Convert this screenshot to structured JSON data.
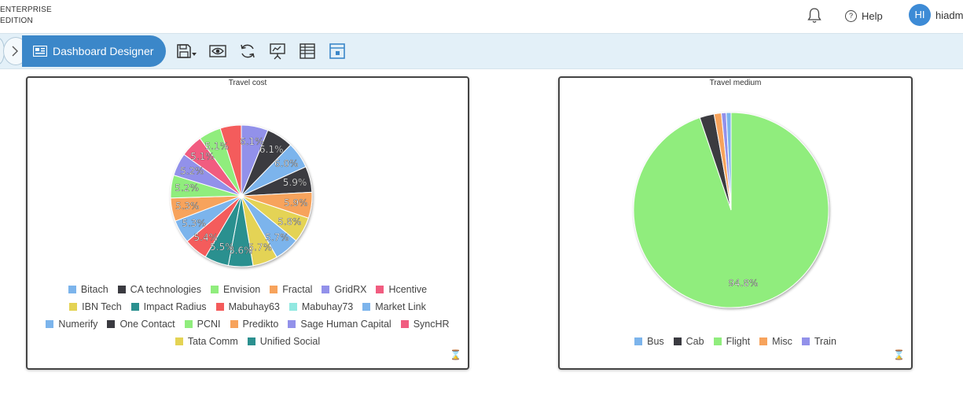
{
  "header": {
    "brand_line1": "ENTERPRISE",
    "brand_line2": "EDITION",
    "help_label": "Help",
    "avatar_initials": "HI",
    "username": "hiadm"
  },
  "toolbar": {
    "dashboard_designer_label": "Dashboard Designer",
    "icons": [
      "save-icon",
      "preview-icon",
      "refresh-icon",
      "presentation-icon",
      "table-icon",
      "layout-icon"
    ]
  },
  "colors": {
    "accent": "#3b87c9",
    "toolbar_bg": "#e3f0f8"
  },
  "chart_data": [
    {
      "type": "pie",
      "title": "Travel cost",
      "legend_rows": [
        [
          "Bitach",
          "CA technologies",
          "Envision",
          "Fractal",
          "GridRX",
          "Hcentive"
        ],
        [
          "IBN Tech",
          "Impact Radius",
          "Mabuhay63",
          "Mabuhay73",
          "Market Link"
        ],
        [
          "Numerify",
          "One Contact",
          "PCNI",
          "Predikto",
          "Sage Human Capital",
          "SyncHR"
        ],
        [
          "Tata Comm",
          "Unified Social"
        ]
      ],
      "slices": [
        {
          "name": "GridRX",
          "value": 6.1,
          "color": "#9291ea",
          "label": "6.1%"
        },
        {
          "name": "One Contact",
          "value": 6.1,
          "color": "#3a3a40",
          "label": "6.1%"
        },
        {
          "name": "Market Link",
          "value": 6.0,
          "color": "#7cb4ec",
          "label": "6.0%"
        },
        {
          "name": "CA technologies",
          "value": 5.9,
          "color": "#3a3a40",
          "label": "5.9%"
        },
        {
          "name": "Fractal",
          "value": 5.9,
          "color": "#f7a35c",
          "label": "5.9%"
        },
        {
          "name": "Tata Comm",
          "value": 5.8,
          "color": "#e4d354",
          "label": "5.8%"
        },
        {
          "name": "Numerify",
          "value": 5.7,
          "color": "#7cb4ec",
          "label": "5.7%"
        },
        {
          "name": "IBN Tech",
          "value": 5.7,
          "color": "#e4d354",
          "label": "5.7%"
        },
        {
          "name": "Unified Social",
          "value": 5.6,
          "color": "#2b908f",
          "label": "5.6%"
        },
        {
          "name": "Impact Radius",
          "value": 5.5,
          "color": "#2b908f",
          "label": "5.5%"
        },
        {
          "name": "Mabuhay63",
          "value": 5.4,
          "color": "#f45b5b",
          "label": "5.4%"
        },
        {
          "name": "Bitach",
          "value": 5.3,
          "color": "#7cb4ec",
          "label": "5.3%"
        },
        {
          "name": "Predikto",
          "value": 5.3,
          "color": "#f7a35c",
          "label": "5.3%"
        },
        {
          "name": "PCNI",
          "value": 5.2,
          "color": "#90ed7d",
          "label": "5.2%"
        },
        {
          "name": "Sage Human Capital",
          "value": 5.2,
          "color": "#9291ea",
          "label": "5.2%"
        },
        {
          "name": "Hcentive",
          "value": 5.1,
          "color": "#f15c80",
          "label": "5.1%"
        },
        {
          "name": "Envision",
          "value": 5.1,
          "color": "#90ed7d",
          "label": "5.1%"
        },
        {
          "name": "Mabuhay73",
          "value": 0.0,
          "color": "#91e8e1",
          "label": ""
        },
        {
          "name": "SyncHR",
          "value": 0.0,
          "color": "#f15c80",
          "label": ""
        },
        {
          "name": "Mabuhay63",
          "value": 4.8,
          "color": "#f45b5b",
          "label": ""
        }
      ],
      "legend_colors": {
        "Bitach": "#7cb4ec",
        "CA technologies": "#3a3a40",
        "Envision": "#90ed7d",
        "Fractal": "#f7a35c",
        "GridRX": "#9291ea",
        "Hcentive": "#f15c80",
        "IBN Tech": "#e4d354",
        "Impact Radius": "#2b908f",
        "Mabuhay63": "#f45b5b",
        "Mabuhay73": "#91e8e1",
        "Market Link": "#7cb4ec",
        "Numerify": "#7cb4ec",
        "One Contact": "#3a3a40",
        "PCNI": "#90ed7d",
        "Predikto": "#f7a35c",
        "Sage Human Capital": "#9291ea",
        "SyncHR": "#f15c80",
        "Tata Comm": "#e4d354",
        "Unified Social": "#2b908f"
      }
    },
    {
      "type": "pie",
      "title": "Travel medium",
      "legend_rows": [
        [
          "Bus",
          "Cab",
          "Flight",
          "Misc",
          "Train"
        ]
      ],
      "legend_colors": {
        "Bus": "#7cb4ec",
        "Cab": "#3a3a40",
        "Flight": "#90ed7d",
        "Misc": "#f7a35c",
        "Train": "#9291ea"
      },
      "slices": [
        {
          "name": "Flight",
          "value": 94.8,
          "color": "#90ed7d",
          "label": "94.8%"
        },
        {
          "name": "Cab",
          "value": 2.4,
          "color": "#3a3a40",
          "label": ""
        },
        {
          "name": "Misc",
          "value": 1.2,
          "color": "#f7a35c",
          "label": ""
        },
        {
          "name": "Train",
          "value": 0.8,
          "color": "#9291ea",
          "label": ""
        },
        {
          "name": "Bus",
          "value": 0.8,
          "color": "#7cb4ec",
          "label": ""
        }
      ]
    }
  ]
}
